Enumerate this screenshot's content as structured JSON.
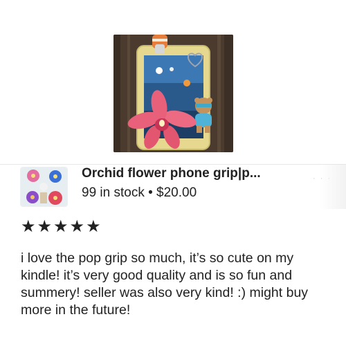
{
  "listing": {
    "title": "Orchid flower phone grip|p...",
    "meta": "99 in stock • $20.00",
    "fade_text": "· · ·"
  },
  "rating": {
    "stars": 5,
    "star_glyph": "★"
  },
  "review": {
    "text": "i love the pop grip so much, it’s so cute on my kindle! it’s very good quality and is so fun and summery! seller was also very kind! :) might buy more in the future!"
  },
  "colors": {
    "text": "#222222",
    "divider": "#e6e6e6",
    "wood": "#4a3a2e",
    "case": "#e8dc9a",
    "orchid": "#e8546a"
  }
}
